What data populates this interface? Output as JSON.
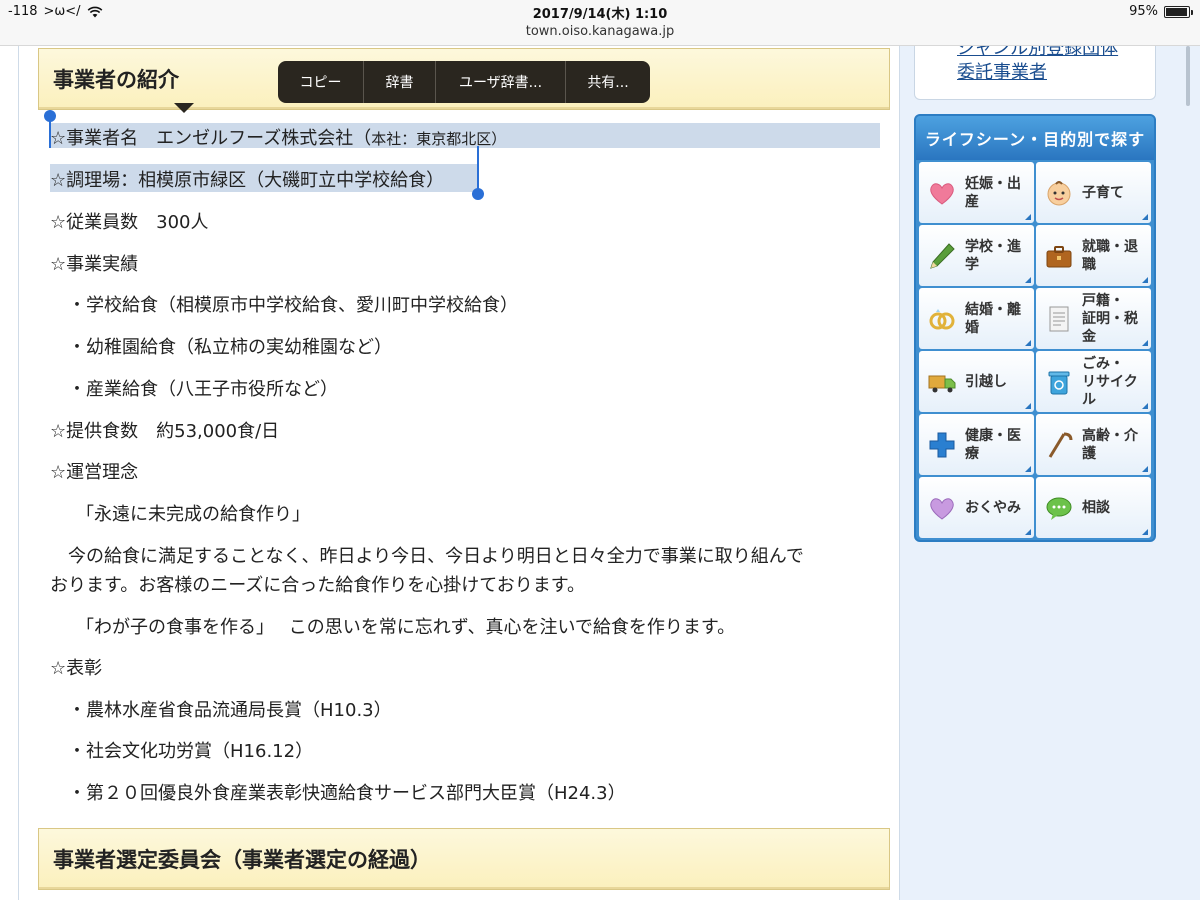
{
  "status_bar": {
    "signal": "-118",
    "carrier": ">ω</",
    "datetime": "2017/9/14(木) 1:10",
    "url": "town.oiso.kanagawa.jp",
    "battery": "95%",
    "battery_level": 0.95
  },
  "main": {
    "section1_title": "事業者の紹介",
    "section2_title": "事業者選定委員会（事業者選定の経過）",
    "lines": [
      "☆事業者名　エンゼルフーズ株式会社（",
      "本社：東京都北区）",
      "☆調理場：相模原市緑区（大磯町立中学校給食）",
      "☆従業員数　300人",
      "☆事業実績",
      "・学校給食（相模原市中学校給食、愛川町中学校給食）",
      "・幼稚園給食（私立柿の実幼稚園など）",
      "・産業給食（八王子市役所など）",
      "☆提供食数　約53,000食/日",
      "☆運営理念",
      "「永遠に未完成の給食作り」",
      "今の給食に満足することなく、昨日より今日、今日より明日と日々全力で事業に取り組んで",
      "おります。お客様のニーズに合った給食作りを心掛けております。",
      "「わが子の食事を作る」　 この思いを常に忘れず、真心を注いで給食を作ります。",
      "☆表彰",
      "・農林水産省食品流通局長賞（H10.3）",
      "・社会文化功労賞（H16.12）",
      "・第２０回優良外食産業表彰快適給食サービス部門大臣賞（H24.3）"
    ]
  },
  "context_menu": {
    "items": [
      "コピー",
      "辞書",
      "ユーザ辞書...",
      "共有..."
    ]
  },
  "sidebar": {
    "link_cut": "ジャンル別登録団体",
    "link": "委託事業者",
    "life_title": "ライフシーン・目的別で探す",
    "tiles": [
      {
        "label": "妊娠・出産",
        "icon": "heart-icon"
      },
      {
        "label": "子育て",
        "icon": "baby-face-icon"
      },
      {
        "label": "学校・進学",
        "icon": "pencil-icon"
      },
      {
        "label": "就職・退職",
        "icon": "briefcase-icon"
      },
      {
        "label": "結婚・離婚",
        "icon": "rings-icon"
      },
      {
        "label": "戸籍・\n証明・税金",
        "icon": "document-icon"
      },
      {
        "label": "引越し",
        "icon": "truck-icon"
      },
      {
        "label": "ごみ・\nリサイクル",
        "icon": "trash-can-icon"
      },
      {
        "label": "健康・医療",
        "icon": "medical-cross-icon"
      },
      {
        "label": "高齢・介護",
        "icon": "cane-icon"
      },
      {
        "label": "おくやみ",
        "icon": "purple-heart-icon"
      },
      {
        "label": "相談",
        "icon": "speech-bubble-icon"
      }
    ],
    "colors": {
      "panel_blue": "#2c7dc3",
      "heading_gold": "#fbf0bd"
    }
  }
}
